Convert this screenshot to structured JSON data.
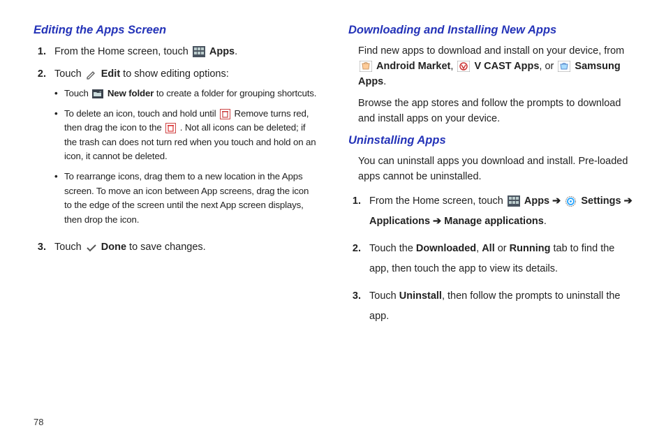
{
  "page_number": "78",
  "left": {
    "heading": "Editing the Apps Screen",
    "steps": [
      {
        "num": "1.",
        "pre": "From the Home screen, touch ",
        "bold_after_icon": "Apps",
        "tail": "."
      },
      {
        "num": "2.",
        "pre": "Touch ",
        "bold_after_icon": "Edit",
        "tail": " to show editing options:"
      },
      {
        "num": "3.",
        "pre": "Touch ",
        "bold_after_icon": "Done",
        "tail": " to save changes."
      }
    ],
    "bullets": {
      "b1": {
        "pre": "Touch ",
        "bold": "New folder",
        "tail": " to create a folder for grouping shortcuts."
      },
      "b2": {
        "pre": "To delete an icon, touch and hold until ",
        "mid1": " Remove turns red, then drag the icon to the ",
        "mid2": ". Not all icons can be deleted; if the trash can does not turn red when you touch and hold on an icon, it cannot be deleted."
      },
      "b3": {
        "text": "To rearrange icons, drag them to a new location in the Apps screen. To move an icon between App screens, drag the icon to the edge of the screen until the next App screen displays, then drop the icon."
      }
    }
  },
  "right": {
    "heading1": "Downloading and Installing New Apps",
    "p1": {
      "pre": "Find new apps to download and install on your device, from ",
      "b1": "Android Market",
      "sep1": ", ",
      "b2": "V CAST Apps",
      "sep2": ", or ",
      "b3": "Samsung Apps",
      "tail": "."
    },
    "p2": "Browse the app stores and follow the prompts to download and install apps on your device.",
    "heading2": "Uninstalling Apps",
    "p3": "You can uninstall apps you download and install. Pre-loaded apps cannot be uninstalled.",
    "steps": {
      "s1": {
        "num": "1.",
        "pre": "From the Home screen, touch ",
        "b1": "Apps",
        "arrow1": "  ➔ ",
        "b2": "Settings",
        "arrow2": " ➔ ",
        "b3": "Applications",
        "arrow3": "  ➔ ",
        "b4": "Manage applications",
        "tail": "."
      },
      "s2": {
        "num": "2.",
        "pre": "Touch the ",
        "b1": "Downloaded",
        "sep1": ", ",
        "b2": "All",
        "sep2": " or ",
        "b3": "Running",
        "tail": " tab to find the app, then touch the app to view its details."
      },
      "s3": {
        "num": "3.",
        "pre": "Touch ",
        "b1": "Uninstall",
        "tail": ", then follow the prompts to uninstall the app."
      }
    }
  }
}
